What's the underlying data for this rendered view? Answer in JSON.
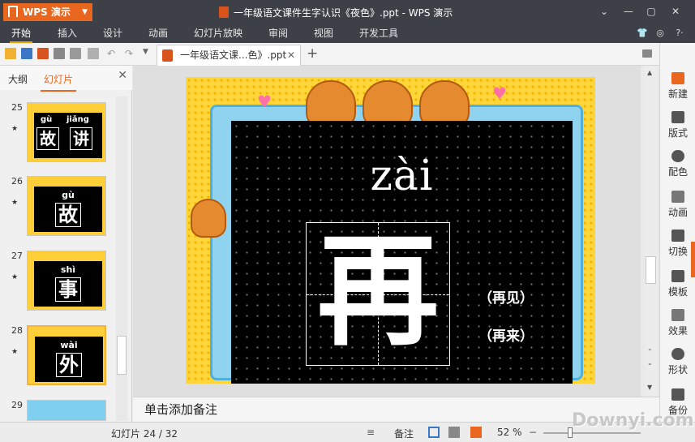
{
  "titlebar": {
    "app_name": "WPS 演示",
    "document_title": "一年级语文课件生字认识《夜色》.ppt - WPS 演示"
  },
  "ribbon": {
    "tabs": [
      "开始",
      "插入",
      "设计",
      "动画",
      "幻灯片放映",
      "审阅",
      "视图",
      "开发工具"
    ]
  },
  "toolbar": {
    "doc_tab_label": "一年级语文课...色》.ppt"
  },
  "left_panel": {
    "tabs": [
      "大纲",
      "幻灯片"
    ],
    "thumbnails": [
      {
        "number": "25",
        "pinyin_a": "gù",
        "pinyin_b": "jiǎng",
        "hanzi_a": "故",
        "hanzi_b": "讲"
      },
      {
        "number": "26",
        "pinyin": "gù",
        "hanzi": "故"
      },
      {
        "number": "27",
        "pinyin": "shì",
        "hanzi": "事"
      },
      {
        "number": "28",
        "pinyin": "wài",
        "hanzi": "外"
      },
      {
        "number": "29"
      }
    ]
  },
  "slide": {
    "pinyin": "zài",
    "hanzi": "再",
    "words": [
      "（再见）",
      "（再来）"
    ]
  },
  "notes": {
    "placeholder": "单击添加备注"
  },
  "right_sidebar": {
    "items": [
      "新建",
      "版式",
      "配色",
      "动画",
      "切换",
      "模板",
      "效果",
      "形状",
      "备份"
    ]
  },
  "statusbar": {
    "slide_info": "幻灯片 24 / 32",
    "notes_label": "备注",
    "zoom": "52 %"
  },
  "watermark": "Downyi.com",
  "colors": {
    "accent": "#e8661e",
    "titlebar": "#3d4147"
  }
}
